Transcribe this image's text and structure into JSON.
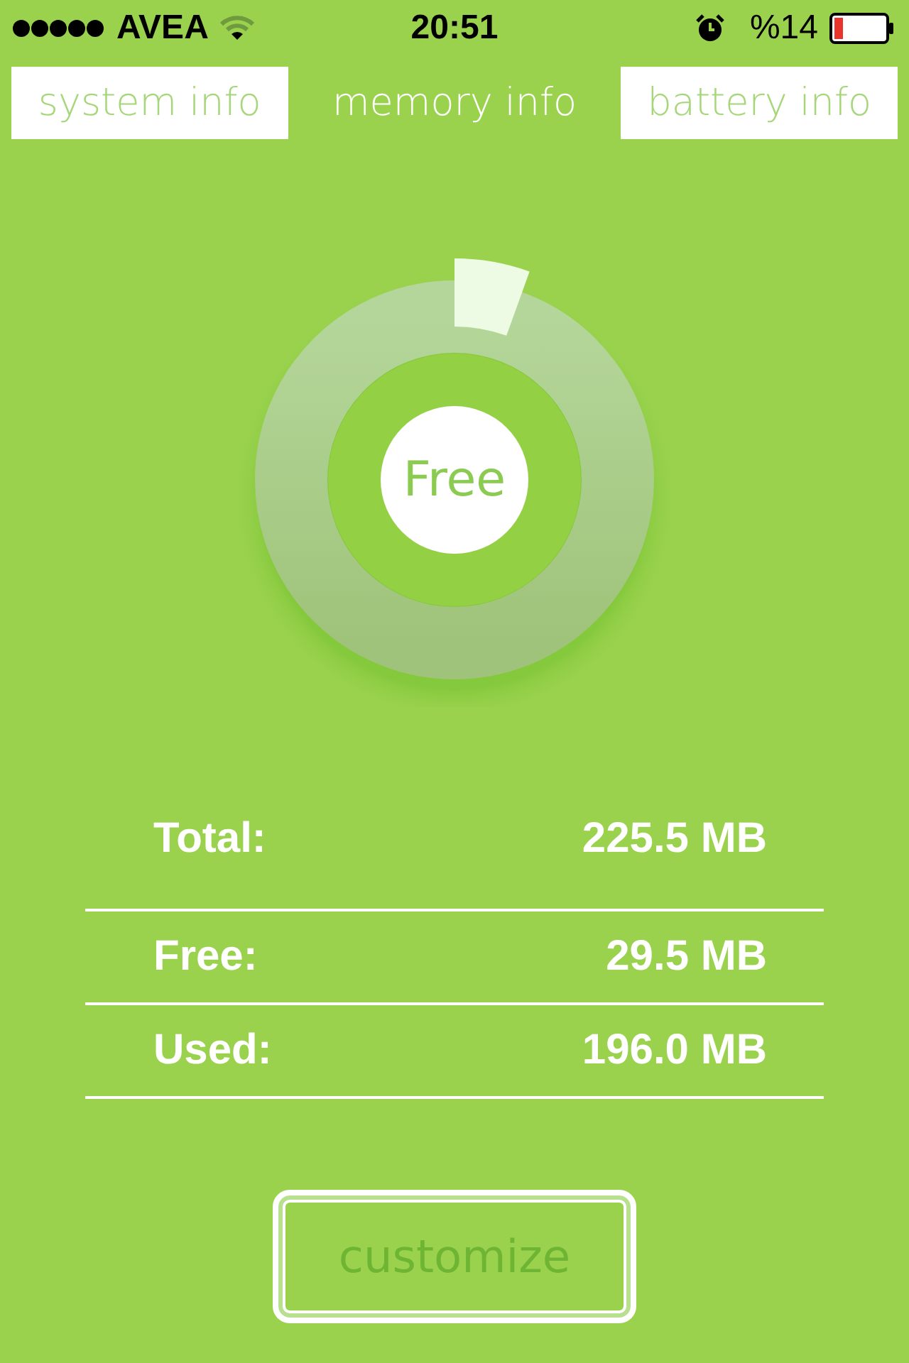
{
  "status_bar": {
    "carrier": "AVEA",
    "time": "20:51",
    "battery": "%14"
  },
  "tabs": [
    {
      "label": "system info",
      "selected": false
    },
    {
      "label": "memory info",
      "selected": true
    },
    {
      "label": "battery info",
      "selected": false
    }
  ],
  "gauge": {
    "label": "Free"
  },
  "stats": [
    {
      "label": "Total:",
      "value": "225.5 MB"
    },
    {
      "label": "Free:",
      "value": "29.5 MB"
    },
    {
      "label": "Used:",
      "value": "196.0 MB"
    }
  ],
  "button": "customize"
}
